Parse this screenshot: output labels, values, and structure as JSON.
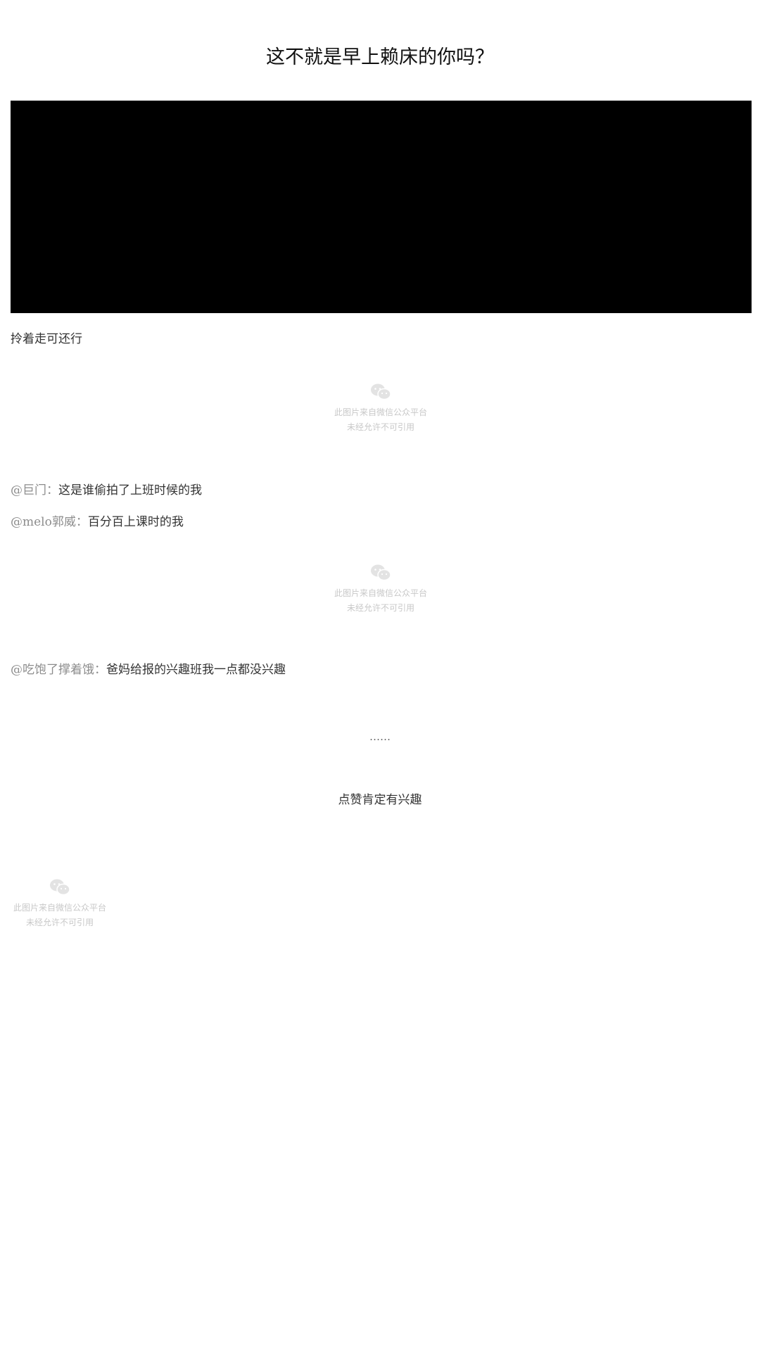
{
  "article": {
    "title": "这不就是早上赖床的你吗？",
    "caption1": "拎着走可还行",
    "placeholder_line1": "此图片来自微信公众平台",
    "placeholder_line2": "未经允许不可引用",
    "comments": [
      {
        "user": "@巨门",
        "sep": "：",
        "text": "这是谁偷拍了上班时候的我"
      },
      {
        "user": "@melo郭威",
        "sep": "：",
        "text": "百分百上课时的我"
      },
      {
        "user": "@吃饱了撑着饿",
        "sep": "：",
        "text": "爸妈给报的兴趣班我一点都没兴趣"
      }
    ],
    "ellipsis": "……",
    "closing": "点赞肯定有兴趣"
  },
  "colors": {
    "video_bg": "#000000",
    "placeholder_gray": "#c8c8c8",
    "username_gray": "#8c8c8c",
    "body_text": "#333333"
  },
  "icons": {
    "placeholder_icon": "wechat-icon"
  }
}
